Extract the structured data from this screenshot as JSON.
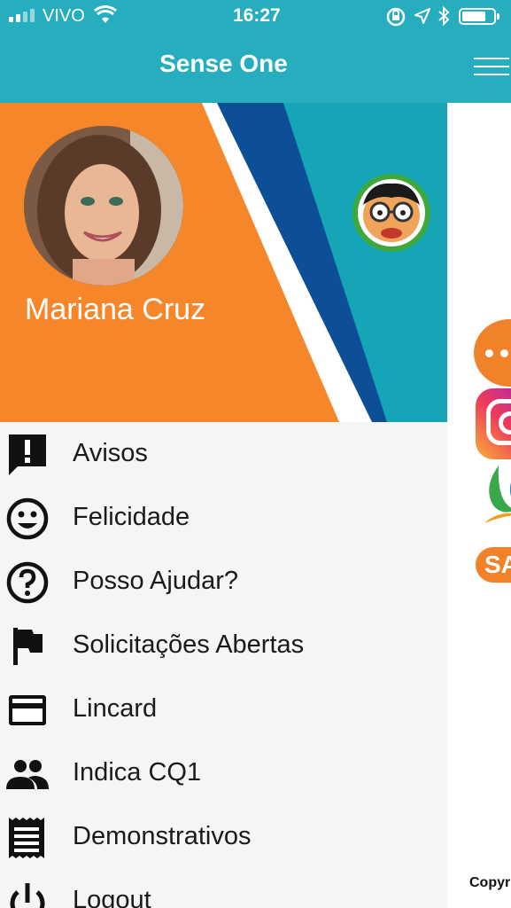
{
  "status_bar": {
    "carrier": "VIVO",
    "time": "16:27"
  },
  "drawer": {
    "title": "Sense One",
    "user": {
      "name": "Mariana Cruz"
    },
    "menu": [
      {
        "label": "Avisos",
        "icon": "announcement-icon"
      },
      {
        "label": "Felicidade",
        "icon": "smiley-icon"
      },
      {
        "label": "Posso Ajudar?",
        "icon": "help-icon"
      },
      {
        "label": "Solicitações Abertas",
        "icon": "flag-icon"
      },
      {
        "label": "Lincard",
        "icon": "credit-card-icon"
      },
      {
        "label": "Indica CQ1",
        "icon": "people-icon"
      },
      {
        "label": "Demonstrativos",
        "icon": "receipt-icon"
      },
      {
        "label": "Logout",
        "icon": "power-icon"
      }
    ]
  },
  "main_screen": {
    "badge_text": "SA",
    "copyright": "Copyr"
  },
  "colors": {
    "teal": "#26aebf",
    "orange": "#f5862a",
    "navy": "#0d4f97",
    "drawer_bg": "#f5f5f5"
  }
}
